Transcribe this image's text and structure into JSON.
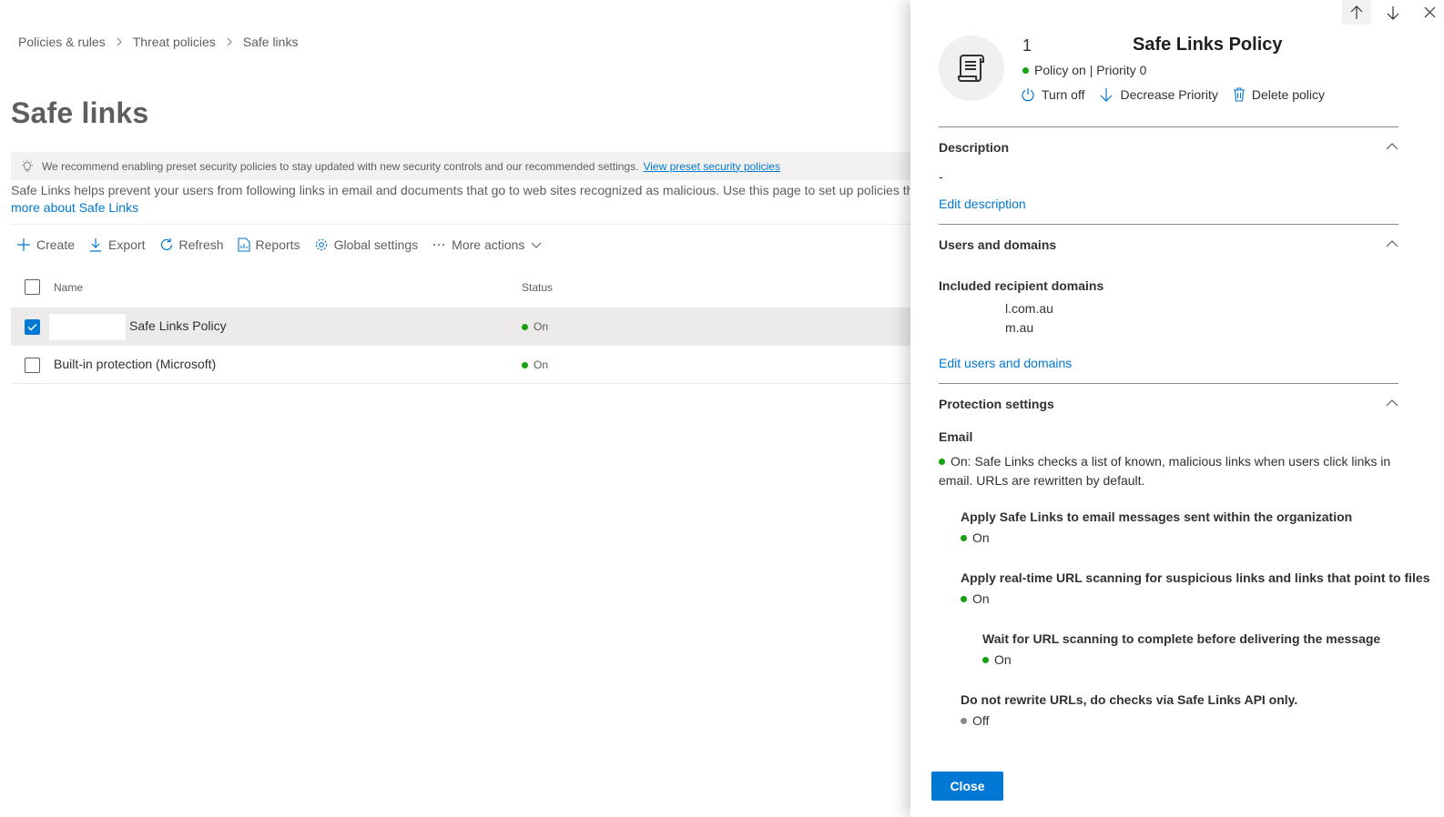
{
  "breadcrumb": [
    "Policies & rules",
    "Threat policies",
    "Safe links"
  ],
  "page_title": "Safe links",
  "banner": {
    "text": "We recommend enabling preset security policies to stay updated with new security controls and our recommended settings.",
    "link": "View preset security policies"
  },
  "intro": {
    "text": "Safe Links helps prevent your users from following links in email and documents that go to web sites recognized as malicious. Use this page to set up policies that",
    "link": "more about Safe Links"
  },
  "toolbar": {
    "create": "Create",
    "export": "Export",
    "refresh": "Refresh",
    "reports": "Reports",
    "global_settings": "Global settings",
    "more_actions": "More actions"
  },
  "table": {
    "columns": {
      "name": "Name",
      "status": "Status"
    },
    "rows": [
      {
        "name": "Safe Links Policy",
        "status": "On",
        "selected": true
      },
      {
        "name": "Built-in protection (Microsoft)",
        "status": "On",
        "selected": false
      }
    ]
  },
  "panel": {
    "title_prefix": "1",
    "title": "Safe Links Policy",
    "state": "Policy on | Priority 0",
    "actions": {
      "turn_off": "Turn off",
      "decrease_priority": "Decrease Priority",
      "delete": "Delete policy"
    },
    "description": {
      "heading": "Description",
      "value": "-",
      "edit_link": "Edit description"
    },
    "users_domains": {
      "heading": "Users and domains",
      "included_label": "Included recipient domains",
      "domains": [
        "l.com.au",
        "m.au"
      ],
      "edit_link": "Edit users and domains"
    },
    "protection": {
      "heading": "Protection settings",
      "email_label": "Email",
      "email_desc": "On: Safe Links checks a list of known, malicious links when users click links in email. URLs are rewritten by default.",
      "settings": [
        {
          "title": "Apply Safe Links to email messages sent within the organization",
          "value": "On"
        },
        {
          "title": "Apply real-time URL scanning for suspicious links and links that point to files",
          "value": "On"
        },
        {
          "title": "Wait for URL scanning to complete before delivering the message",
          "value": "On"
        },
        {
          "title": "Do not rewrite URLs, do checks via Safe Links API only.",
          "value": "Off"
        }
      ]
    },
    "close_label": "Close"
  },
  "colors": {
    "accent": "#0078d4",
    "status_on": "#13a10e",
    "status_off": "#8a8886"
  }
}
